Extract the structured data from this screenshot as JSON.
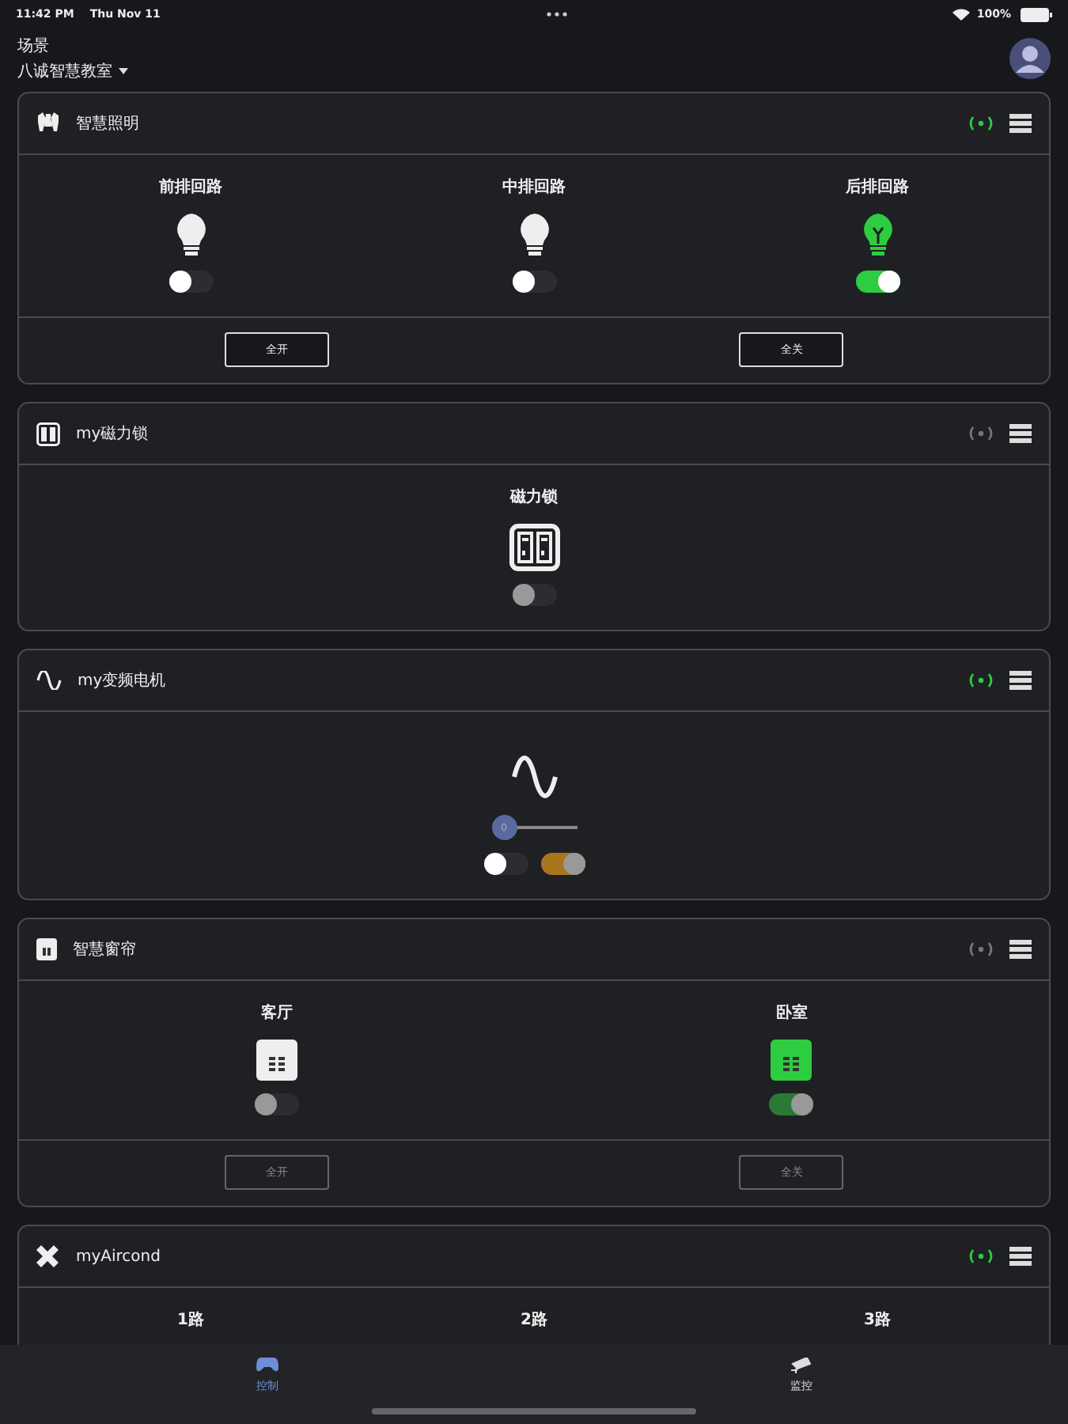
{
  "status_bar": {
    "time": "11:42 PM",
    "date": "Thu Nov 11",
    "battery": "100%"
  },
  "header": {
    "caption": "场景",
    "scene": "八诚智慧教室"
  },
  "cards": [
    {
      "title": "智慧照明",
      "kind": "lighting",
      "online": true,
      "items": [
        {
          "label": "前排回路",
          "kind": "bulb",
          "toggle": {
            "on": false,
            "disabled": false
          }
        },
        {
          "label": "中排回路",
          "kind": "bulb",
          "toggle": {
            "on": false,
            "disabled": false
          }
        },
        {
          "label": "后排回路",
          "kind": "bulb",
          "toggle": {
            "on": true,
            "disabled": false
          }
        }
      ],
      "buttons": [
        {
          "label": "全开",
          "disabled": false
        },
        {
          "label": "全关",
          "disabled": false
        }
      ]
    },
    {
      "title": "my磁力锁",
      "kind": "lock",
      "online": false,
      "items": [
        {
          "label": "磁力锁",
          "kind": "lock",
          "toggle": {
            "on": false,
            "disabled": true
          }
        }
      ]
    },
    {
      "title": "my变频电机",
      "kind": "motor",
      "online": true,
      "items": [
        {
          "kind": "motor",
          "slider": {
            "level": 0,
            "reading": "0"
          },
          "toggles": [
            {
              "on": false,
              "disabled": false
            },
            {
              "on": true,
              "disabled": true,
              "color": "#a8741c"
            }
          ]
        }
      ]
    },
    {
      "title": "智慧窗帘",
      "kind": "curtain",
      "online": false,
      "items": [
        {
          "label": "客厅",
          "kind": "curtain",
          "toggle": {
            "on": false,
            "disabled": true
          }
        },
        {
          "label": "卧室",
          "kind": "curtain",
          "toggle": {
            "on": true,
            "disabled": true
          }
        }
      ],
      "buttons": [
        {
          "label": "全开",
          "disabled": true
        },
        {
          "label": "全关",
          "disabled": true
        }
      ]
    },
    {
      "title": "myAircond",
      "kind": "aircon",
      "online": true,
      "items": [
        {
          "label": "1路",
          "kind": "channel"
        },
        {
          "label": "2路",
          "kind": "channel"
        },
        {
          "label": "3路",
          "kind": "channel"
        }
      ]
    }
  ],
  "tabs": [
    {
      "label": "控制",
      "kind": "control",
      "selected": true
    },
    {
      "label": "监控",
      "kind": "monitor",
      "selected": false
    }
  ]
}
